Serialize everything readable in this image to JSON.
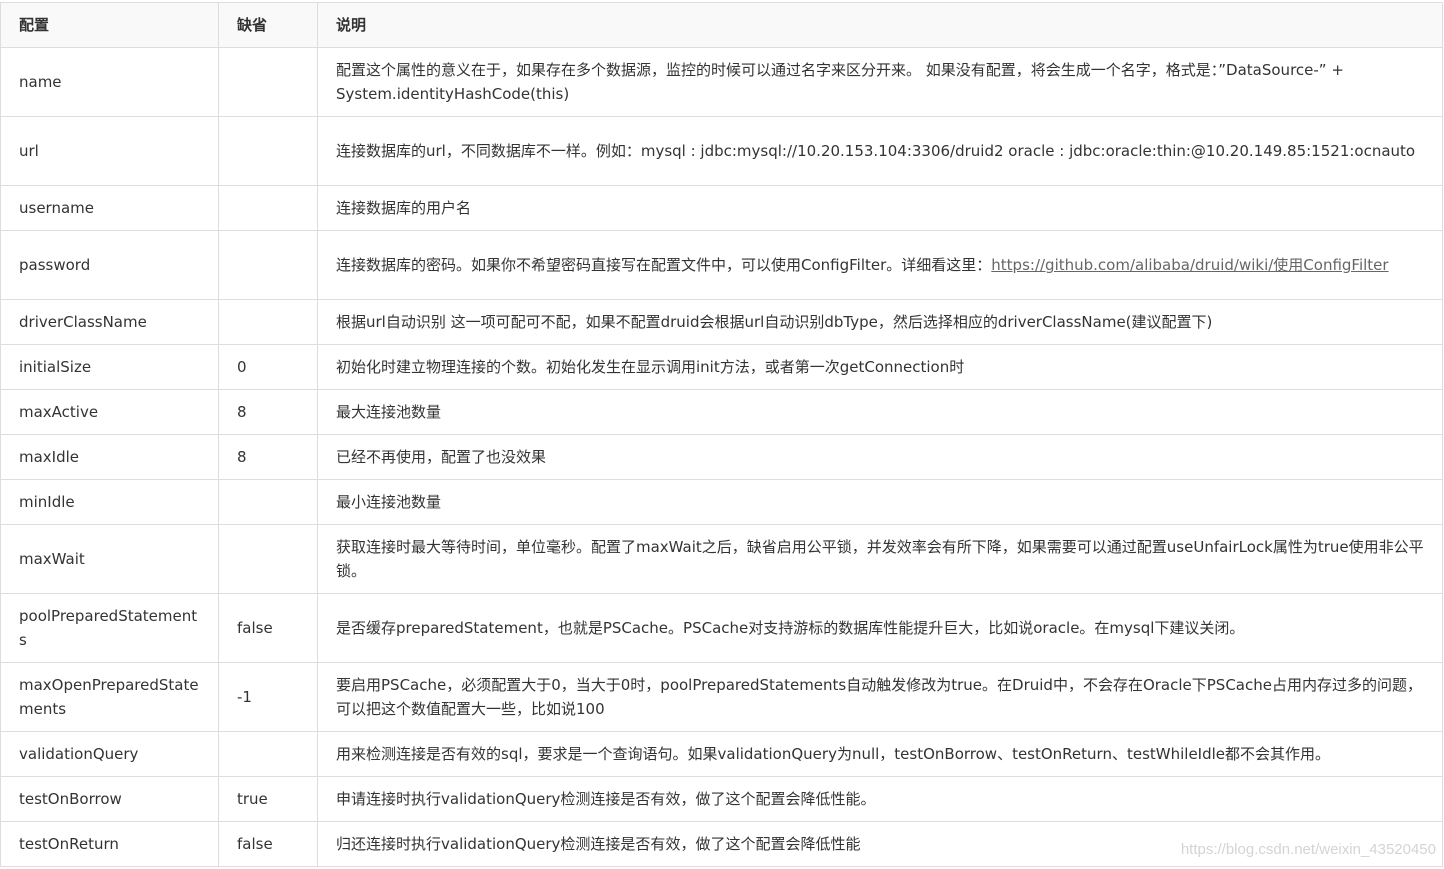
{
  "table": {
    "headers": {
      "config": "配置",
      "default": "缺省",
      "desc": "说明"
    },
    "rows": [
      {
        "name": "name",
        "default": "",
        "desc": "配置这个属性的意义在于，如果存在多个数据源，监控的时候可以通过名字来区分开来。 如果没有配置，将会生成一个名字，格式是：”DataSource-” + System.identityHashCode(this)"
      },
      {
        "name": "url",
        "default": "",
        "desc": "连接数据库的url，不同数据库不一样。例如：mysql : jdbc:mysql://10.20.153.104:3306/druid2 oracle : jdbc:oracle:thin:@10.20.149.85:1521:ocnauto"
      },
      {
        "name": "username",
        "default": "",
        "desc": "连接数据库的用户名"
      },
      {
        "name": "password",
        "default": "",
        "desc_prefix": "连接数据库的密码。如果你不希望密码直接写在配置文件中，可以使用ConfigFilter。详细看这里：",
        "desc_link": "https://github.com/alibaba/druid/wiki/使用ConfigFilter"
      },
      {
        "name": "driverClassName",
        "default": "",
        "desc": "根据url自动识别 这一项可配可不配，如果不配置druid会根据url自动识别dbType，然后选择相应的driverClassName(建议配置下)"
      },
      {
        "name": "initialSize",
        "default": "0",
        "desc": "初始化时建立物理连接的个数。初始化发生在显示调用init方法，或者第一次getConnection时"
      },
      {
        "name": "maxActive",
        "default": "8",
        "desc": "最大连接池数量"
      },
      {
        "name": "maxIdle",
        "default": "8",
        "desc": "已经不再使用，配置了也没效果"
      },
      {
        "name": "minIdle",
        "default": "",
        "desc": "最小连接池数量"
      },
      {
        "name": "maxWait",
        "default": "",
        "desc": "获取连接时最大等待时间，单位毫秒。配置了maxWait之后，缺省启用公平锁，并发效率会有所下降，如果需要可以通过配置useUnfairLock属性为true使用非公平锁。"
      },
      {
        "name": "poolPreparedStatements",
        "default": "false",
        "desc": "是否缓存preparedStatement，也就是PSCache。PSCache对支持游标的数据库性能提升巨大，比如说oracle。在mysql下建议关闭。"
      },
      {
        "name": "maxOpenPreparedStatements",
        "default": "-1",
        "desc": "要启用PSCache，必须配置大于0，当大于0时，poolPreparedStatements自动触发修改为true。在Druid中，不会存在Oracle下PSCache占用内存过多的问题，可以把这个数值配置大一些，比如说100"
      },
      {
        "name": "validationQuery",
        "default": "",
        "desc": "用来检测连接是否有效的sql，要求是一个查询语句。如果validationQuery为null，testOnBorrow、testOnReturn、testWhileIdle都不会其作用。"
      },
      {
        "name": "testOnBorrow",
        "default": "true",
        "desc": "申请连接时执行validationQuery检测连接是否有效，做了这个配置会降低性能。"
      },
      {
        "name": "testOnReturn",
        "default": "false",
        "desc": "归还连接时执行validationQuery检测连接是否有效，做了这个配置会降低性能"
      }
    ]
  },
  "watermark": "https://blog.csdn.net/weixin_43520450"
}
